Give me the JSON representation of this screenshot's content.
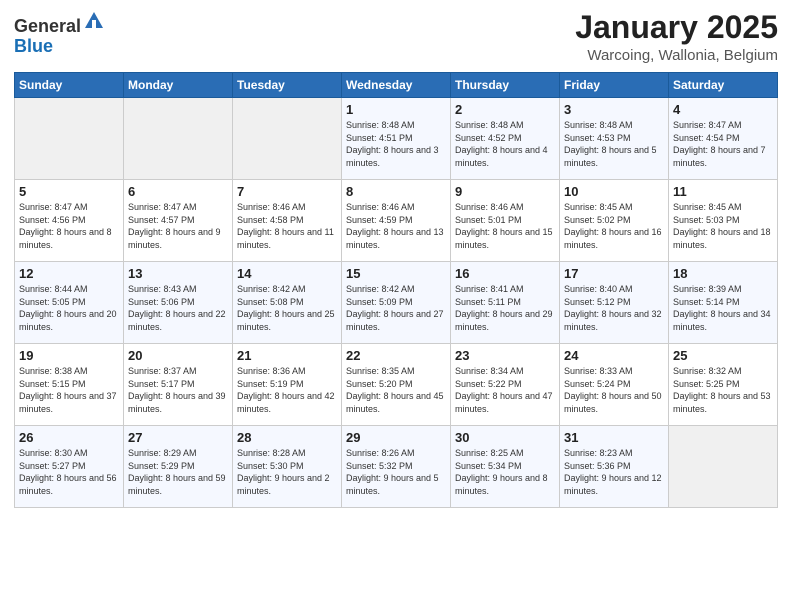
{
  "logo": {
    "general": "General",
    "blue": "Blue"
  },
  "header": {
    "title": "January 2025",
    "subtitle": "Warcoing, Wallonia, Belgium"
  },
  "days_of_week": [
    "Sunday",
    "Monday",
    "Tuesday",
    "Wednesday",
    "Thursday",
    "Friday",
    "Saturday"
  ],
  "weeks": [
    [
      {
        "day": "",
        "info": ""
      },
      {
        "day": "",
        "info": ""
      },
      {
        "day": "",
        "info": ""
      },
      {
        "day": "1",
        "info": "Sunrise: 8:48 AM\nSunset: 4:51 PM\nDaylight: 8 hours and 3 minutes."
      },
      {
        "day": "2",
        "info": "Sunrise: 8:48 AM\nSunset: 4:52 PM\nDaylight: 8 hours and 4 minutes."
      },
      {
        "day": "3",
        "info": "Sunrise: 8:48 AM\nSunset: 4:53 PM\nDaylight: 8 hours and 5 minutes."
      },
      {
        "day": "4",
        "info": "Sunrise: 8:47 AM\nSunset: 4:54 PM\nDaylight: 8 hours and 7 minutes."
      }
    ],
    [
      {
        "day": "5",
        "info": "Sunrise: 8:47 AM\nSunset: 4:56 PM\nDaylight: 8 hours and 8 minutes."
      },
      {
        "day": "6",
        "info": "Sunrise: 8:47 AM\nSunset: 4:57 PM\nDaylight: 8 hours and 9 minutes."
      },
      {
        "day": "7",
        "info": "Sunrise: 8:46 AM\nSunset: 4:58 PM\nDaylight: 8 hours and 11 minutes."
      },
      {
        "day": "8",
        "info": "Sunrise: 8:46 AM\nSunset: 4:59 PM\nDaylight: 8 hours and 13 minutes."
      },
      {
        "day": "9",
        "info": "Sunrise: 8:46 AM\nSunset: 5:01 PM\nDaylight: 8 hours and 15 minutes."
      },
      {
        "day": "10",
        "info": "Sunrise: 8:45 AM\nSunset: 5:02 PM\nDaylight: 8 hours and 16 minutes."
      },
      {
        "day": "11",
        "info": "Sunrise: 8:45 AM\nSunset: 5:03 PM\nDaylight: 8 hours and 18 minutes."
      }
    ],
    [
      {
        "day": "12",
        "info": "Sunrise: 8:44 AM\nSunset: 5:05 PM\nDaylight: 8 hours and 20 minutes."
      },
      {
        "day": "13",
        "info": "Sunrise: 8:43 AM\nSunset: 5:06 PM\nDaylight: 8 hours and 22 minutes."
      },
      {
        "day": "14",
        "info": "Sunrise: 8:42 AM\nSunset: 5:08 PM\nDaylight: 8 hours and 25 minutes."
      },
      {
        "day": "15",
        "info": "Sunrise: 8:42 AM\nSunset: 5:09 PM\nDaylight: 8 hours and 27 minutes."
      },
      {
        "day": "16",
        "info": "Sunrise: 8:41 AM\nSunset: 5:11 PM\nDaylight: 8 hours and 29 minutes."
      },
      {
        "day": "17",
        "info": "Sunrise: 8:40 AM\nSunset: 5:12 PM\nDaylight: 8 hours and 32 minutes."
      },
      {
        "day": "18",
        "info": "Sunrise: 8:39 AM\nSunset: 5:14 PM\nDaylight: 8 hours and 34 minutes."
      }
    ],
    [
      {
        "day": "19",
        "info": "Sunrise: 8:38 AM\nSunset: 5:15 PM\nDaylight: 8 hours and 37 minutes."
      },
      {
        "day": "20",
        "info": "Sunrise: 8:37 AM\nSunset: 5:17 PM\nDaylight: 8 hours and 39 minutes."
      },
      {
        "day": "21",
        "info": "Sunrise: 8:36 AM\nSunset: 5:19 PM\nDaylight: 8 hours and 42 minutes."
      },
      {
        "day": "22",
        "info": "Sunrise: 8:35 AM\nSunset: 5:20 PM\nDaylight: 8 hours and 45 minutes."
      },
      {
        "day": "23",
        "info": "Sunrise: 8:34 AM\nSunset: 5:22 PM\nDaylight: 8 hours and 47 minutes."
      },
      {
        "day": "24",
        "info": "Sunrise: 8:33 AM\nSunset: 5:24 PM\nDaylight: 8 hours and 50 minutes."
      },
      {
        "day": "25",
        "info": "Sunrise: 8:32 AM\nSunset: 5:25 PM\nDaylight: 8 hours and 53 minutes."
      }
    ],
    [
      {
        "day": "26",
        "info": "Sunrise: 8:30 AM\nSunset: 5:27 PM\nDaylight: 8 hours and 56 minutes."
      },
      {
        "day": "27",
        "info": "Sunrise: 8:29 AM\nSunset: 5:29 PM\nDaylight: 8 hours and 59 minutes."
      },
      {
        "day": "28",
        "info": "Sunrise: 8:28 AM\nSunset: 5:30 PM\nDaylight: 9 hours and 2 minutes."
      },
      {
        "day": "29",
        "info": "Sunrise: 8:26 AM\nSunset: 5:32 PM\nDaylight: 9 hours and 5 minutes."
      },
      {
        "day": "30",
        "info": "Sunrise: 8:25 AM\nSunset: 5:34 PM\nDaylight: 9 hours and 8 minutes."
      },
      {
        "day": "31",
        "info": "Sunrise: 8:23 AM\nSunset: 5:36 PM\nDaylight: 9 hours and 12 minutes."
      },
      {
        "day": "",
        "info": ""
      }
    ]
  ]
}
